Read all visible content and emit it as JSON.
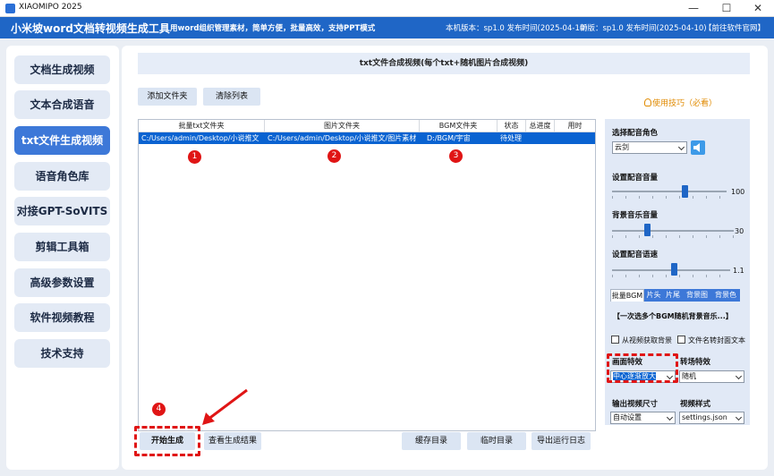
{
  "window": {
    "title": "XIAOMIPO 2025",
    "min_glyph": "—",
    "max_glyph": "☐",
    "close_glyph": "✕"
  },
  "header": {
    "app_title": "小米坡word文档转视频生成工具",
    "slogan": "用word组织管理素材，简单方便，批量高效，支持PPT模式",
    "local_version": "本机版本：sp1.0  发布时间(2025-04-10)",
    "new_version": "新版：sp1.0 发布时间(2025-04-10)",
    "website": "【前往软件官网】"
  },
  "sidebar": {
    "items": [
      {
        "label": "文档生成视频"
      },
      {
        "label": "文本合成语音"
      },
      {
        "label": "txt文件生成视频",
        "active": true
      },
      {
        "label": "语音角色库"
      },
      {
        "label": "对接GPT-SoVITS"
      },
      {
        "label": "剪辑工具箱"
      },
      {
        "label": "高级参数设置"
      },
      {
        "label": "软件视频教程"
      },
      {
        "label": "技术支持"
      }
    ]
  },
  "content": {
    "banner": "txt文件合成视频(每个txt+随机图片合成视频)",
    "add_folder": "添加文件夹",
    "clear_list": "清除列表",
    "tips": "使用技巧（必看）",
    "table": {
      "headers": [
        "批量txt文件夹",
        "图片文件夹",
        "BGM文件夹",
        "状态",
        "总进度",
        "用时"
      ],
      "rows": [
        {
          "txt": "C:/Users/admin/Desktop/小说推文",
          "img": "C:/Users/admin/Desktop/小说推文/图片素材",
          "bgm": "D:/BGM/宇宙",
          "status": "待处理",
          "progress": "",
          "time": ""
        }
      ]
    },
    "markers": [
      "1",
      "2",
      "3",
      "4"
    ],
    "start": "开始生成",
    "view_result": "查看生成结果",
    "cache_dir": "缓存目录",
    "temp_dir": "临时目录",
    "export_log": "导出运行日志"
  },
  "right": {
    "voice_label": "选择配音角色",
    "voice_value": "云剑",
    "dub_volume_label": "设置配音音量",
    "dub_volume": "100",
    "bgm_volume_label": "背景音乐音量",
    "bgm_volume": "30",
    "speed_label": "设置配音语速",
    "speed": "1.1",
    "tabs": [
      "批量BGM",
      "片头",
      "片尾",
      "背景图",
      "背景色"
    ],
    "bgm_note": "【一次选多个BGM随机背景音乐...】",
    "cb_bg": "从视频获取背景",
    "cb_cover": "文件名转封面文本",
    "effect_label": "画面特效",
    "effect_value": "中心逐渐放大",
    "trans_label": "转场特效",
    "trans_value": "随机",
    "size_label": "输出视频尺寸",
    "size_value": "自动设置",
    "style_label": "视频样式",
    "style_value": "settings.json"
  },
  "colors": {
    "brand_blue": "#1f66c6",
    "accent_red": "#e01515",
    "selected_row": "#0a63d1",
    "tips_orange": "#e08a00"
  }
}
